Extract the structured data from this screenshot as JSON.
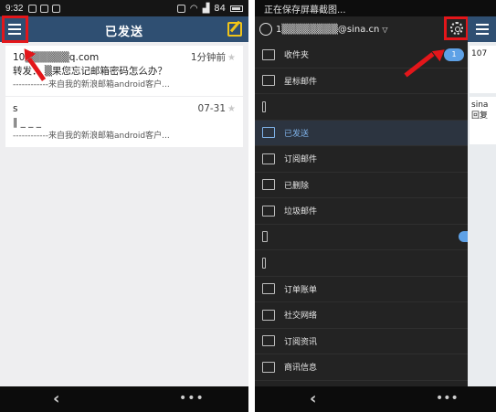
{
  "left": {
    "status": {
      "time": "9:32",
      "signal_text": "",
      "battery_level": "84"
    },
    "appbar": {
      "title": "已发送"
    },
    "mails": [
      {
        "recipient": "10▒▒▒▒▒▒q.com",
        "time": "1分钟前",
        "subject": "转发：  ▒果您忘记邮箱密码怎么办？",
        "signature": "------------来自我的新浪邮箱android客户..."
      },
      {
        "recipient": "s",
        "time": "07-31",
        "subject": "‖ _ _ _",
        "signature": "------------来自我的新浪邮箱android客户..."
      }
    ]
  },
  "right": {
    "status": {
      "text": "正在保存屏幕截图..."
    },
    "drawer": {
      "account": "1▒▒▒▒▒▒▒▒@sina.cn",
      "items": [
        {
          "label": "收件夹",
          "badge": "1"
        },
        {
          "label": "星标邮件"
        },
        {
          "label": ""
        },
        {
          "label": "已发送"
        },
        {
          "label": "订阅邮件"
        },
        {
          "label": "已删除"
        },
        {
          "label": "垃圾邮件"
        },
        {
          "label": ""
        },
        {
          "label": ""
        },
        {
          "label": "订单账单"
        },
        {
          "label": "社交网络"
        },
        {
          "label": "订阅资讯"
        },
        {
          "label": "商讯信息"
        }
      ]
    },
    "under": {
      "mail1": "107",
      "mail2a": "sina",
      "mail2b": "回复"
    }
  },
  "colors": {
    "accent": "#2f4f72",
    "highlight": "#e3161a",
    "badge": "#5ea1e6"
  }
}
